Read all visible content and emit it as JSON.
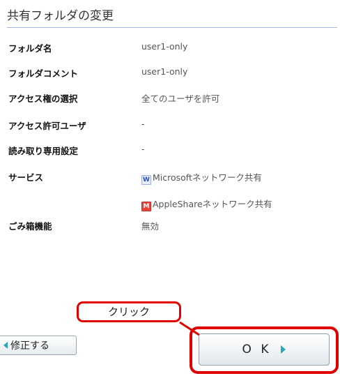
{
  "page": {
    "title": "共有フォルダの変更"
  },
  "fields": [
    {
      "label": "フォルダ名",
      "value": "user1-only"
    },
    {
      "label": "フォルダコメント",
      "value": "user1-only"
    },
    {
      "label": "アクセス権の選択",
      "value": "全てのユーザを許可"
    },
    {
      "label": "アクセス許可ユーザ",
      "value": "-"
    },
    {
      "label": "読み取り専用設定",
      "value": "-"
    },
    {
      "label": "サービス",
      "value": ""
    },
    {
      "label": "ごみ箱機能",
      "value": "無効"
    }
  ],
  "services": [
    {
      "icon": "W",
      "label": "Microsoftネットワーク共有"
    },
    {
      "icon": "M",
      "label": "AppleShareネットワーク共有"
    }
  ],
  "callout": {
    "text": "クリック"
  },
  "buttons": {
    "fix": "修正する",
    "ok": "O K"
  },
  "colors": {
    "highlight": "#e00000",
    "arrow": "#2aa5b8",
    "title_rule": "#9fb8d9"
  }
}
